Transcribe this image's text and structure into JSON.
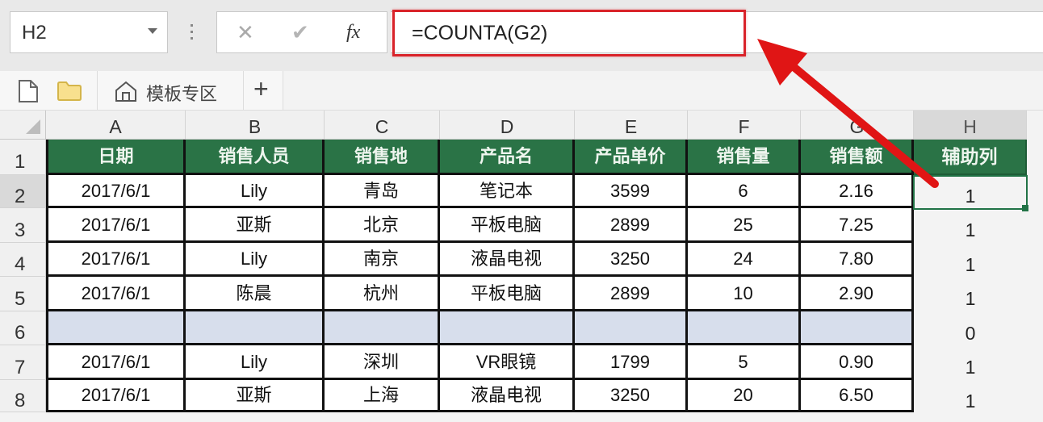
{
  "formula_bar": {
    "name_box": "H2",
    "cancel_icon": "close-icon",
    "confirm_icon": "check-icon",
    "fx_label": "fx",
    "formula": "=COUNTA(G2)"
  },
  "tab_bar": {
    "new_icon": "file-icon",
    "open_icon": "folder-icon",
    "home_icon": "home-icon",
    "template_tab": "模板专区",
    "add_tab": "+"
  },
  "annotation": {
    "highlight_color": "#d9232a",
    "arrow": "red arrow pointing to formula bar"
  },
  "sheet": {
    "accent": "#2a7346",
    "blank_row_color": "#d7deec",
    "columns": [
      "A",
      "B",
      "C",
      "D",
      "E",
      "F",
      "G",
      "H"
    ],
    "selected_cell": "H2",
    "header_row": [
      "日期",
      "销售人员",
      "销售地",
      "产品名",
      "产品单价",
      "销售量",
      "销售额",
      "辅助列"
    ],
    "rows": [
      {
        "num": "1"
      },
      {
        "num": "2",
        "cells": [
          "2017/6/1",
          "Lily",
          "青岛",
          "笔记本",
          "3599",
          "6",
          "2.16",
          "1"
        ]
      },
      {
        "num": "3",
        "cells": [
          "2017/6/1",
          "亚斯",
          "北京",
          "平板电脑",
          "2899",
          "25",
          "7.25",
          "1"
        ]
      },
      {
        "num": "4",
        "cells": [
          "2017/6/1",
          "Lily",
          "南京",
          "液晶电视",
          "3250",
          "24",
          "7.80",
          "1"
        ]
      },
      {
        "num": "5",
        "cells": [
          "2017/6/1",
          "陈晨",
          "杭州",
          "平板电脑",
          "2899",
          "10",
          "2.90",
          "1"
        ]
      },
      {
        "num": "6",
        "cells": [
          "",
          "",
          "",
          "",
          "",
          "",
          "",
          "0"
        ]
      },
      {
        "num": "7",
        "cells": [
          "2017/6/1",
          "Lily",
          "深圳",
          "VR眼镜",
          "1799",
          "5",
          "0.90",
          "1"
        ]
      },
      {
        "num": "8",
        "cells": [
          "2017/6/1",
          "亚斯",
          "上海",
          "液晶电视",
          "3250",
          "20",
          "6.50",
          "1"
        ]
      }
    ]
  }
}
